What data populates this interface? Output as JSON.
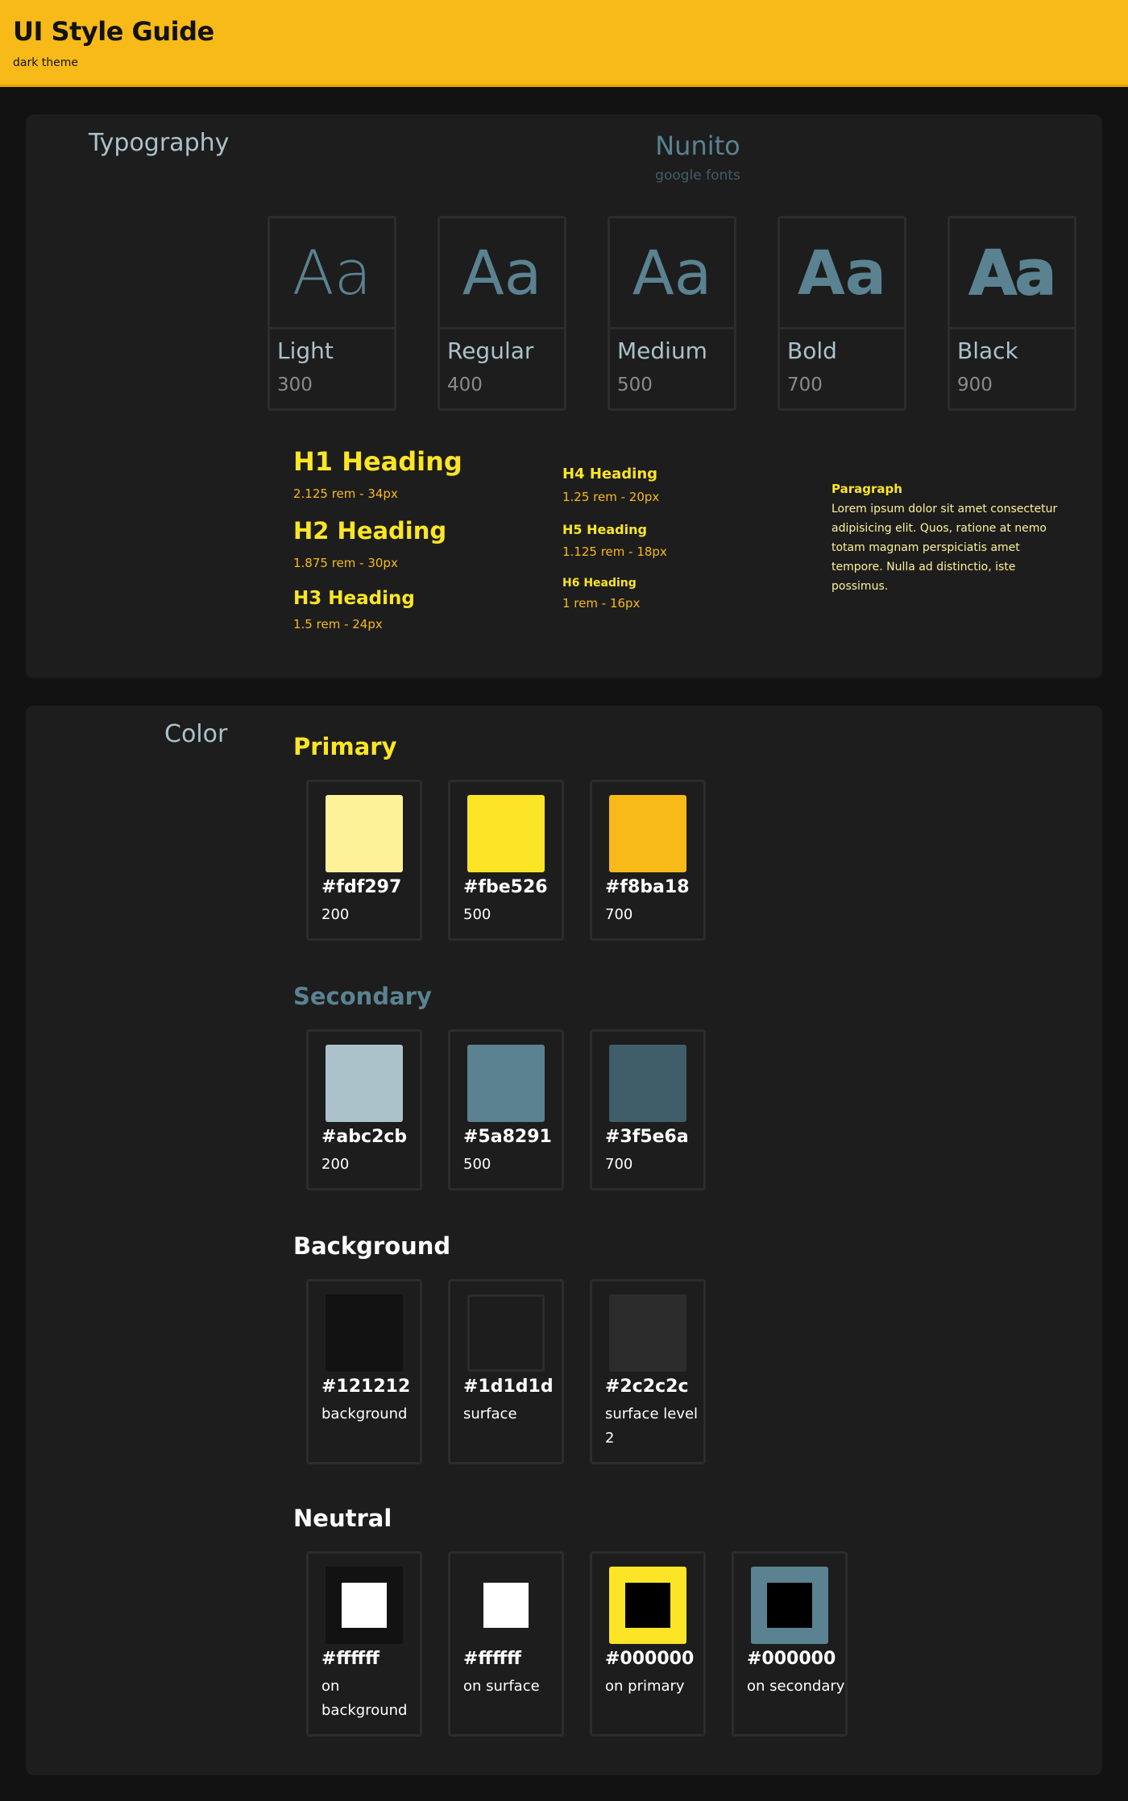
{
  "header": {
    "title": "UI Style Guide",
    "subtitle": "dark theme"
  },
  "typography": {
    "title": "Typography",
    "font_name": "Nunito",
    "font_source": "google fonts",
    "sample": "Aa",
    "weights": [
      {
        "name": "Light",
        "value": "300"
      },
      {
        "name": "Regular",
        "value": "400"
      },
      {
        "name": "Medium",
        "value": "500"
      },
      {
        "name": "Bold",
        "value": "700"
      },
      {
        "name": "Black",
        "value": "900"
      }
    ],
    "headings": [
      {
        "label": "H1 Heading",
        "size": "2.125 rem - 34px"
      },
      {
        "label": "H2 Heading",
        "size": "1.875 rem - 30px"
      },
      {
        "label": "H3 Heading",
        "size": "1.5 rem - 24px"
      },
      {
        "label": "H4 Heading",
        "size": "1.25 rem - 20px"
      },
      {
        "label": "H5 Heading",
        "size": "1.125 rem - 18px"
      },
      {
        "label": "H6 Heading",
        "size": "1 rem - 16px"
      }
    ],
    "paragraph_title": "Paragraph",
    "paragraph_text": "Lorem ipsum dolor sit amet consectetur adipisicing elit. Quos, ratione at nemo totam magnam perspiciatis amet tempore. Nulla ad distinctio, iste possimus."
  },
  "color": {
    "title": "Color",
    "groups": [
      {
        "title": "Primary",
        "title_color": "#fbe526",
        "swatches": [
          {
            "hex": "#fdf297",
            "label": "200",
            "color": "#fdf297"
          },
          {
            "hex": "#fbe526",
            "label": "500",
            "color": "#fbe526"
          },
          {
            "hex": "#f8ba18",
            "label": "700",
            "color": "#f8ba18"
          }
        ]
      },
      {
        "title": "Secondary",
        "title_color": "#5a8291",
        "swatches": [
          {
            "hex": "#abc2cb",
            "label": "200",
            "color": "#abc2cb"
          },
          {
            "hex": "#5a8291",
            "label": "500",
            "color": "#5a8291"
          },
          {
            "hex": "#3f5e6a",
            "label": "700",
            "color": "#3f5e6a"
          }
        ]
      },
      {
        "title": "Background",
        "title_color": "#ffffff",
        "swatches": [
          {
            "hex": "#121212",
            "label": "background",
            "color": "#121212"
          },
          {
            "hex": "#1d1d1d",
            "label": "surface",
            "color": "#1d1d1d"
          },
          {
            "hex": "#2c2c2c",
            "label": "surface level 2",
            "color": "#2c2c2c"
          }
        ]
      },
      {
        "title": "Neutral",
        "title_color": "#ffffff",
        "swatches": [
          {
            "hex": "#ffffff",
            "label": "on background",
            "color": "#ffffff",
            "base": "#121212"
          },
          {
            "hex": "#ffffff",
            "label": "on surface",
            "color": "#ffffff",
            "base": "#1d1d1d"
          },
          {
            "hex": "#000000",
            "label": "on primary",
            "color": "#000000",
            "base": "#fbe526"
          },
          {
            "hex": "#000000",
            "label": "on secondary",
            "color": "#000000",
            "base": "#5a8291"
          }
        ]
      }
    ]
  }
}
